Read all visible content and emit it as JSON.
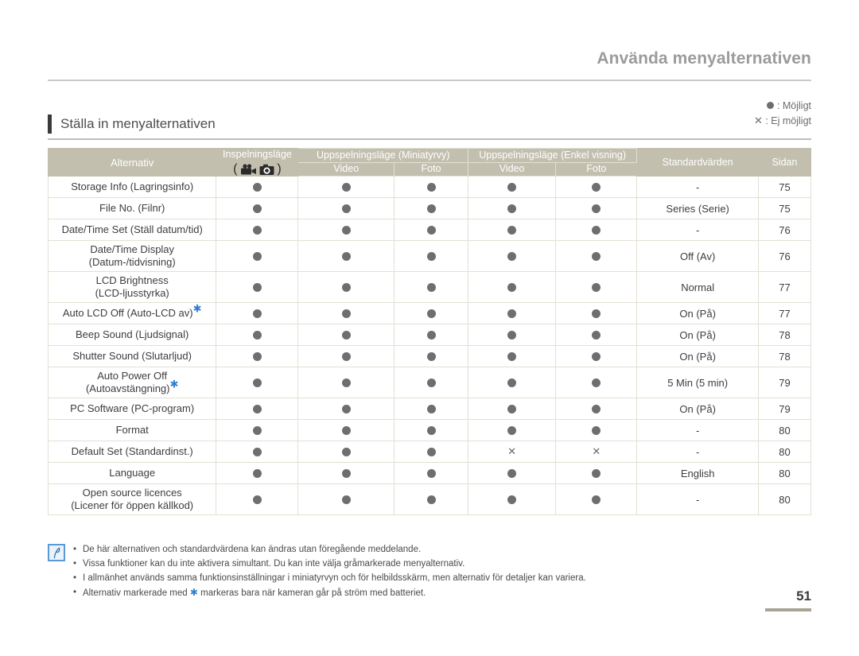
{
  "running_header": "Använda menyalternativen",
  "legend": {
    "possible_icon": "filled-dot",
    "possible_label": ": Möjligt",
    "not_possible_icon": "x-mark",
    "not_possible_label": ": Ej möjligt"
  },
  "section": {
    "title": "Ställa in menyalternativen"
  },
  "table": {
    "headers": {
      "option": "Alternativ",
      "record_mode": "Inspelningsläge",
      "record_mode_icons": "camcorder-icon, camera-icon",
      "playback_thumb": "Uppspelningsläge (Miniatyrvy)",
      "playback_single": "Uppspelningsläge (Enkel visning)",
      "video": "Video",
      "photo": "Foto",
      "defaults": "Standardvärden",
      "page": "Sidan"
    },
    "rows": [
      {
        "option": "Storage Info (Lagringsinfo)",
        "star": false,
        "twoline": false,
        "marks": [
          "dot",
          "dot",
          "dot",
          "dot",
          "dot"
        ],
        "default": "-",
        "page": "75"
      },
      {
        "option": "File No. (Filnr)",
        "star": false,
        "twoline": false,
        "marks": [
          "dot",
          "dot",
          "dot",
          "dot",
          "dot"
        ],
        "default": "Series (Serie)",
        "page": "75"
      },
      {
        "option": "Date/Time Set (Ställ datum/tid)",
        "star": false,
        "twoline": false,
        "marks": [
          "dot",
          "dot",
          "dot",
          "dot",
          "dot"
        ],
        "default": "-",
        "page": "76"
      },
      {
        "option": "Date/Time Display",
        "option_line2": "(Datum-/tidvisning)",
        "star": false,
        "twoline": true,
        "marks": [
          "dot",
          "dot",
          "dot",
          "dot",
          "dot"
        ],
        "default": "Off (Av)",
        "page": "76"
      },
      {
        "option": "LCD Brightness",
        "option_line2": "(LCD-ljusstyrka)",
        "star": false,
        "twoline": true,
        "marks": [
          "dot",
          "dot",
          "dot",
          "dot",
          "dot"
        ],
        "default": "Normal",
        "page": "77"
      },
      {
        "option": "Auto LCD Off (Auto-LCD av)",
        "star": true,
        "twoline": false,
        "marks": [
          "dot",
          "dot",
          "dot",
          "dot",
          "dot"
        ],
        "default": "On (På)",
        "page": "77"
      },
      {
        "option": "Beep Sound (Ljudsignal)",
        "star": false,
        "twoline": false,
        "marks": [
          "dot",
          "dot",
          "dot",
          "dot",
          "dot"
        ],
        "default": "On (På)",
        "page": "78"
      },
      {
        "option": "Shutter Sound (Slutarljud)",
        "star": false,
        "twoline": false,
        "marks": [
          "dot",
          "dot",
          "dot",
          "dot",
          "dot"
        ],
        "default": "On (På)",
        "page": "78"
      },
      {
        "option": "Auto Power Off",
        "option_line2": "(Autoavstängning)",
        "star": true,
        "twoline": true,
        "marks": [
          "dot",
          "dot",
          "dot",
          "dot",
          "dot"
        ],
        "default": "5 Min (5 min)",
        "page": "79"
      },
      {
        "option": "PC Software (PC-program)",
        "star": false,
        "twoline": false,
        "marks": [
          "dot",
          "dot",
          "dot",
          "dot",
          "dot"
        ],
        "default": "On (På)",
        "page": "79"
      },
      {
        "option": "Format",
        "star": false,
        "twoline": false,
        "marks": [
          "dot",
          "dot",
          "dot",
          "dot",
          "dot"
        ],
        "default": "-",
        "page": "80"
      },
      {
        "option": "Default Set (Standardinst.)",
        "star": false,
        "twoline": false,
        "marks": [
          "dot",
          "dot",
          "dot",
          "x",
          "x"
        ],
        "default": "-",
        "page": "80"
      },
      {
        "option": "Language",
        "star": false,
        "twoline": false,
        "marks": [
          "dot",
          "dot",
          "dot",
          "dot",
          "dot"
        ],
        "default": "English",
        "page": "80"
      },
      {
        "option": "Open source licences",
        "option_line2": "(Licener för öppen källkod)",
        "star": false,
        "twoline": true,
        "marks": [
          "dot",
          "dot",
          "dot",
          "dot",
          "dot"
        ],
        "default": "-",
        "page": "80"
      }
    ]
  },
  "notes": {
    "icon": "note-pen-icon",
    "items": [
      "De här alternativen och standardvärdena kan ändras utan föregående meddelande.",
      "Vissa funktioner kan du inte aktivera simultant. Du kan inte välja gråmarkerade menyalternativ.",
      "I allmänhet används samma funktionsinställningar i miniatyrvyn och för helbildsskärm, men alternativ för detaljer kan variera."
    ],
    "star_note_before": "Alternativ markerade med ",
    "star_note_after": " markeras bara när kameran går på ström med batteriet."
  },
  "folio": "51"
}
